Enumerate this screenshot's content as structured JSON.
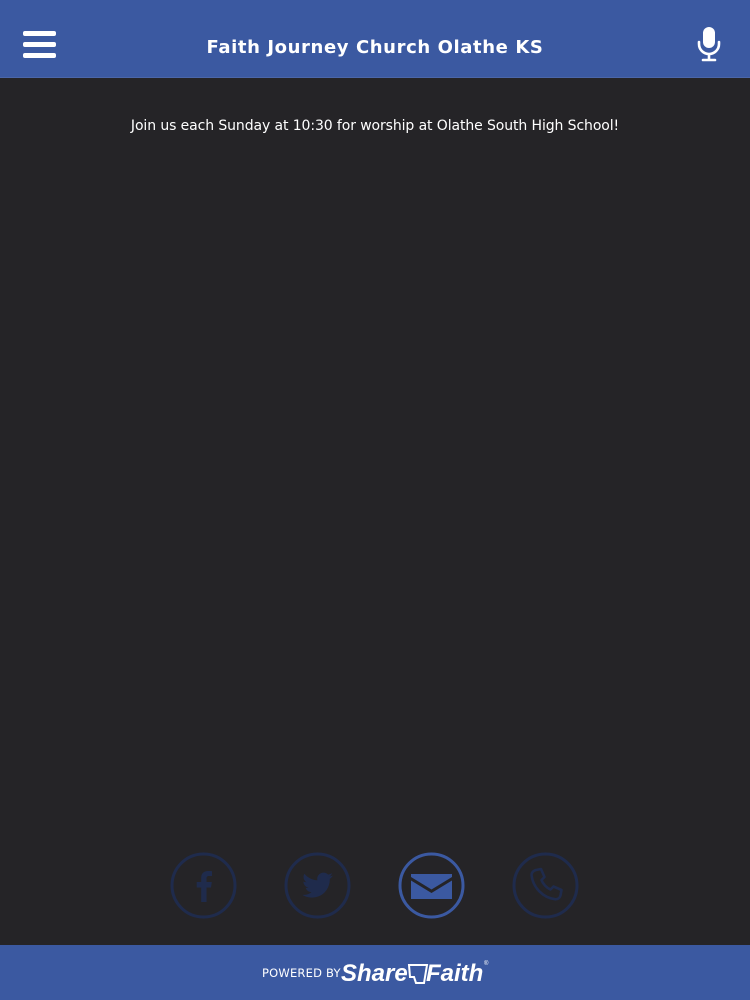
{
  "header": {
    "title": "Faith Journey Church Olathe KS",
    "menu_icon": "hamburger-menu-icon",
    "mic_icon": "microphone-icon"
  },
  "main": {
    "announcement": "Join us each Sunday at 10:30 for worship at Olathe South High School!"
  },
  "social": [
    {
      "name": "facebook",
      "icon": "facebook-icon",
      "state": "dim"
    },
    {
      "name": "twitter",
      "icon": "twitter-icon",
      "state": "dim"
    },
    {
      "name": "email",
      "icon": "email-icon",
      "state": "active"
    },
    {
      "name": "phone",
      "icon": "phone-icon",
      "state": "dim"
    }
  ],
  "footer": {
    "powered_by": "POWERED BY",
    "brand": "ShareFaith"
  },
  "colors": {
    "header_bg": "#3b59a1",
    "page_bg": "#252427",
    "footer_bg": "#3b59a1",
    "social_active": "#3b59a1",
    "social_dim": "#1f2b4c"
  }
}
